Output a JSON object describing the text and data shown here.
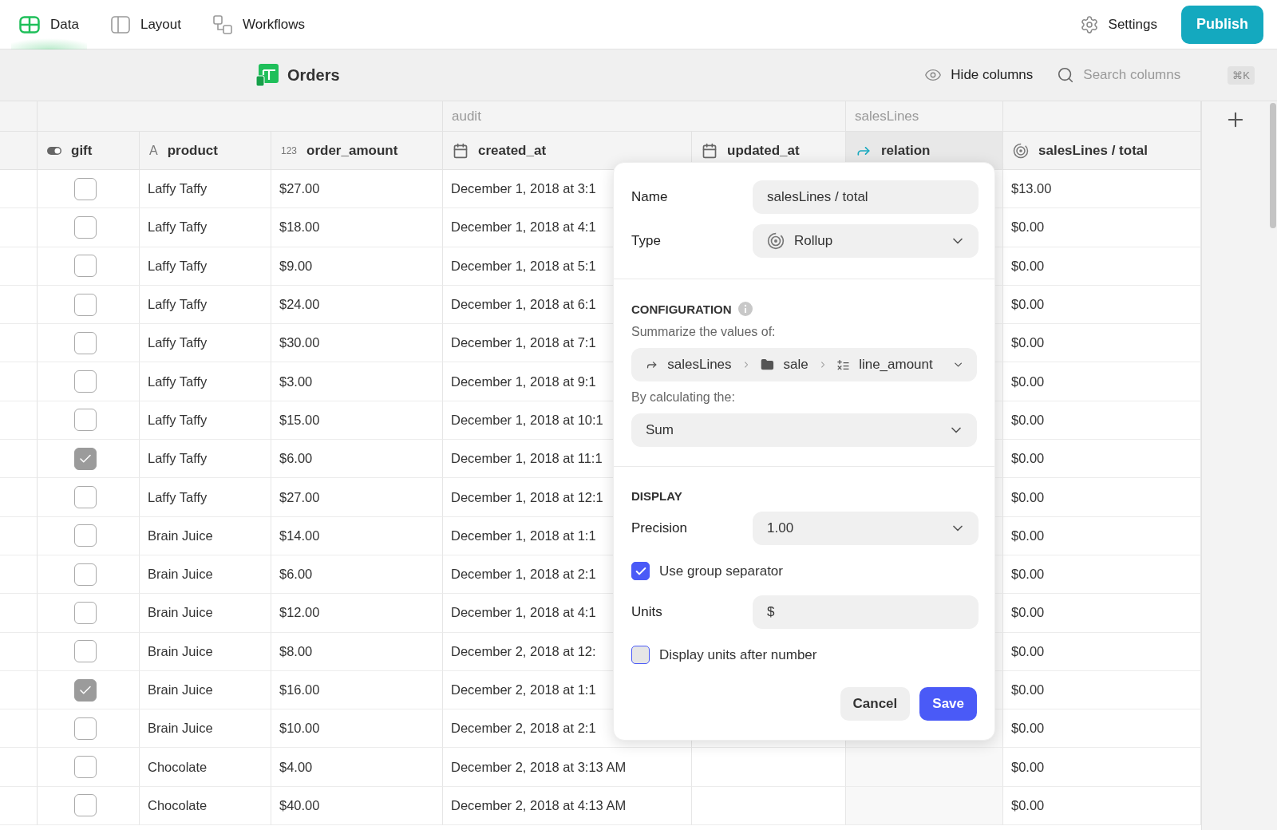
{
  "nav": {
    "tabs": [
      {
        "label": "Data",
        "kind": "data",
        "selected": true
      },
      {
        "label": "Layout",
        "kind": "layout",
        "selected": false
      },
      {
        "label": "Workflows",
        "kind": "workflows",
        "selected": false
      }
    ],
    "settings": "Settings",
    "publish": "Publish"
  },
  "toolbar": {
    "title": "Orders",
    "hide_columns": "Hide columns",
    "search": {
      "placeholder": "Search columns"
    },
    "shortcut": "⌘K"
  },
  "table": {
    "column_groups": [
      {
        "columns": [
          {
            "name": "gift",
            "kind": "toggle",
            "highlighted": false
          },
          {
            "name": "product",
            "kind": "text",
            "icon_text": "A",
            "highlighted": false
          },
          {
            "name": "order_amount",
            "kind": "number",
            "icon_text": "123",
            "highlighted": false
          }
        ]
      },
      {
        "label": "audit",
        "columns": [
          {
            "name": "created_at",
            "kind": "date",
            "highlighted": false
          },
          {
            "name": "updated_at",
            "kind": "date",
            "highlighted": false
          }
        ]
      },
      {
        "label": "salesLines",
        "columns": [
          {
            "name": "relation",
            "kind": "relation",
            "highlighted": true
          }
        ]
      },
      {
        "columns": [
          {
            "name": "salesLines / total",
            "kind": "rollup",
            "highlighted": false
          }
        ]
      }
    ],
    "rows": [
      {
        "gift": false,
        "product": "Laffy Taffy",
        "order_amount": "$27.00",
        "created_at": "December 1, 2018 at 3:1",
        "total": "$13.00"
      },
      {
        "gift": false,
        "product": "Laffy Taffy",
        "order_amount": "$18.00",
        "created_at": "December 1, 2018 at 4:1",
        "total": "$0.00"
      },
      {
        "gift": false,
        "product": "Laffy Taffy",
        "order_amount": "$9.00",
        "created_at": "December 1, 2018 at 5:1",
        "total": "$0.00"
      },
      {
        "gift": false,
        "product": "Laffy Taffy",
        "order_amount": "$24.00",
        "created_at": "December 1, 2018 at 6:1",
        "total": "$0.00"
      },
      {
        "gift": false,
        "product": "Laffy Taffy",
        "order_amount": "$30.00",
        "created_at": "December 1, 2018 at 7:1",
        "total": "$0.00"
      },
      {
        "gift": false,
        "product": "Laffy Taffy",
        "order_amount": "$3.00",
        "created_at": "December 1, 2018 at 9:1",
        "total": "$0.00"
      },
      {
        "gift": false,
        "product": "Laffy Taffy",
        "order_amount": "$15.00",
        "created_at": "December 1, 2018 at 10:1",
        "total": "$0.00"
      },
      {
        "gift": true,
        "product": "Laffy Taffy",
        "order_amount": "$6.00",
        "created_at": "December 1, 2018 at 11:1",
        "total": "$0.00"
      },
      {
        "gift": false,
        "product": "Laffy Taffy",
        "order_amount": "$27.00",
        "created_at": "December 1, 2018 at 12:1",
        "total": "$0.00"
      },
      {
        "gift": false,
        "product": "Brain Juice",
        "order_amount": "$14.00",
        "created_at": "December 1, 2018 at 1:1",
        "total": "$0.00"
      },
      {
        "gift": false,
        "product": "Brain Juice",
        "order_amount": "$6.00",
        "created_at": "December 1, 2018 at 2:1",
        "total": "$0.00"
      },
      {
        "gift": false,
        "product": "Brain Juice",
        "order_amount": "$12.00",
        "created_at": "December 1, 2018 at 4:1",
        "total": "$0.00"
      },
      {
        "gift": false,
        "product": "Brain Juice",
        "order_amount": "$8.00",
        "created_at": "December 2, 2018 at 12:",
        "total": "$0.00"
      },
      {
        "gift": true,
        "product": "Brain Juice",
        "order_amount": "$16.00",
        "created_at": "December 2, 2018 at 1:1",
        "total": "$0.00"
      },
      {
        "gift": false,
        "product": "Brain Juice",
        "order_amount": "$10.00",
        "created_at": "December 2, 2018 at 2:1",
        "total": "$0.00"
      },
      {
        "gift": false,
        "product": "Chocolate",
        "order_amount": "$4.00",
        "created_at": "December 2, 2018 at 3:13 AM",
        "total": "$0.00"
      },
      {
        "gift": false,
        "product": "Chocolate",
        "order_amount": "$40.00",
        "created_at": "December 2, 2018 at 4:13 AM",
        "total": "$0.00"
      }
    ]
  },
  "column_editor": {
    "name": {
      "label": "Name",
      "value": "salesLines / total"
    },
    "type": {
      "label": "Type",
      "value": "Rollup"
    },
    "configuration": {
      "heading": "CONFIGURATION",
      "summarize_label": "Summarize the values of:",
      "path": [
        {
          "label": "salesLines",
          "kind": "relation"
        },
        {
          "label": "sale",
          "kind": "folder"
        },
        {
          "label": "line_amount",
          "kind": "formula"
        }
      ],
      "calc_label": "By calculating the:",
      "calc_value": "Sum"
    },
    "display": {
      "heading": "DISPLAY",
      "precision": {
        "label": "Precision",
        "value": "1.00"
      },
      "group_separator": {
        "label": "Use group separator",
        "checked": true
      },
      "units": {
        "label": "Units",
        "value": "$"
      },
      "units_after": {
        "label": "Display units after number",
        "checked": false
      }
    },
    "buttons": [
      {
        "label": "Cancel",
        "kind": "secondary"
      },
      {
        "label": "Save",
        "kind": "primary"
      }
    ]
  }
}
